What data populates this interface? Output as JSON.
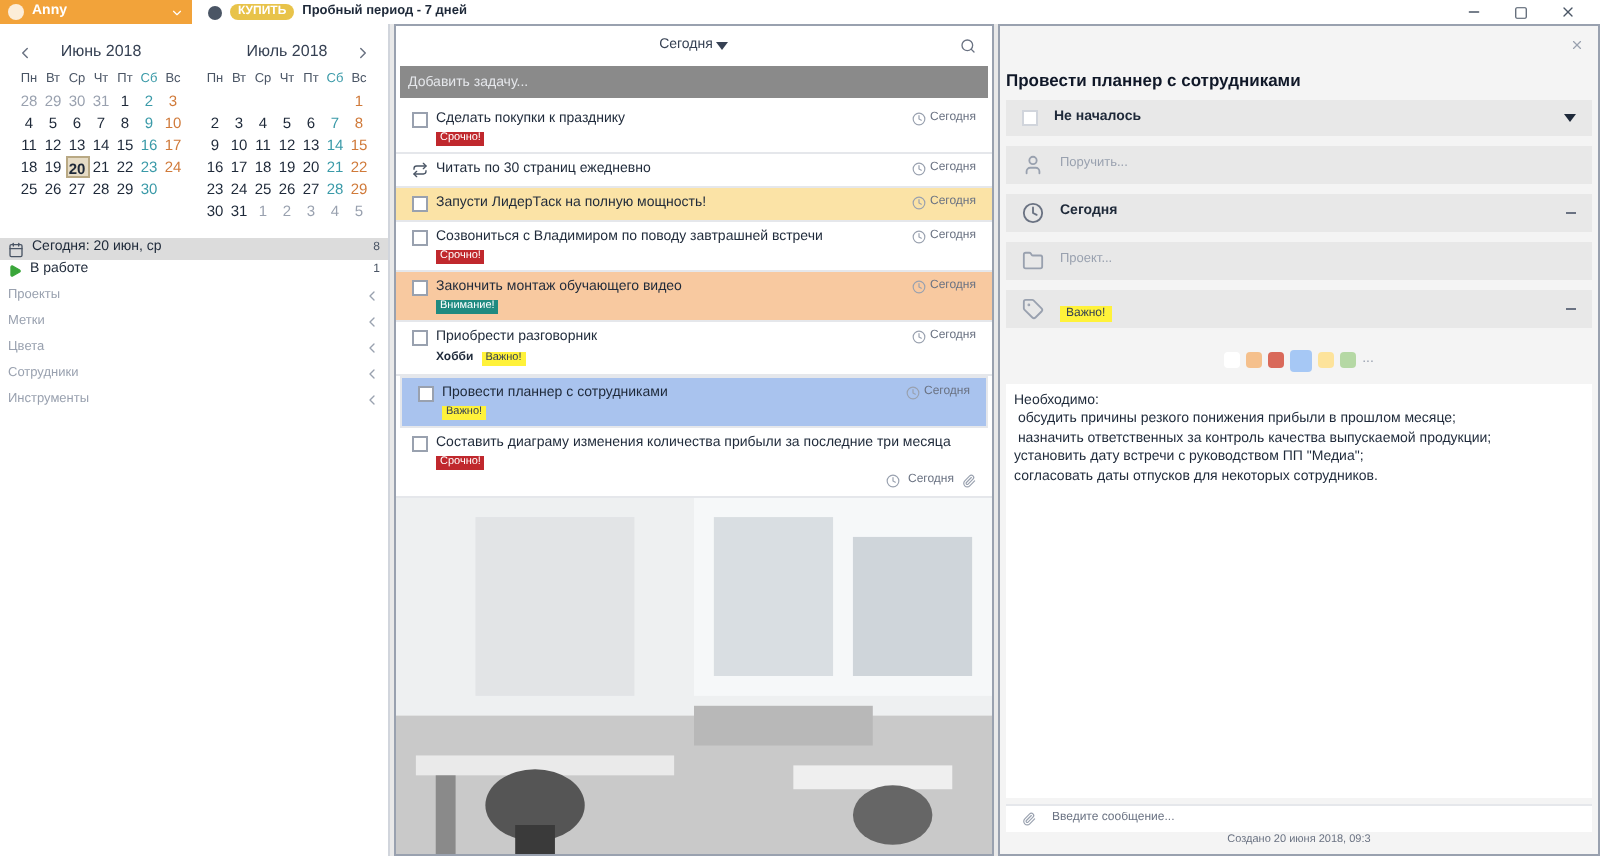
{
  "user": {
    "name": "Anny"
  },
  "topbar": {
    "buy": "КУПИТЬ",
    "trial": "Пробный период - 7 дней"
  },
  "calendars": [
    {
      "month": "Июнь 2018",
      "weekdays": [
        "Пн",
        "Вт",
        "Ср",
        "Чт",
        "Пт",
        "Сб",
        "Вс"
      ],
      "weeks": [
        [
          {
            "d": "28",
            "muted": true,
            "selected": false
          },
          {
            "d": "29",
            "muted": true,
            "selected": false
          },
          {
            "d": "30",
            "muted": true,
            "selected": false
          },
          {
            "d": "31",
            "muted": true,
            "selected": false
          },
          {
            "d": "1",
            "muted": false,
            "selected": false
          },
          {
            "d": "2",
            "muted": false,
            "selected": false
          },
          {
            "d": "3",
            "muted": false,
            "selected": false
          }
        ],
        [
          {
            "d": "4",
            "muted": false,
            "selected": false
          },
          {
            "d": "5",
            "muted": false,
            "selected": false
          },
          {
            "d": "6",
            "muted": false,
            "selected": false
          },
          {
            "d": "7",
            "muted": false,
            "selected": false
          },
          {
            "d": "8",
            "muted": false,
            "selected": false
          },
          {
            "d": "9",
            "muted": false,
            "selected": false
          },
          {
            "d": "10",
            "muted": false,
            "selected": false
          }
        ],
        [
          {
            "d": "11",
            "muted": false,
            "selected": false
          },
          {
            "d": "12",
            "muted": false,
            "selected": false
          },
          {
            "d": "13",
            "muted": false,
            "selected": false
          },
          {
            "d": "14",
            "muted": false,
            "selected": false
          },
          {
            "d": "15",
            "muted": false,
            "selected": false
          },
          {
            "d": "16",
            "muted": false,
            "selected": false
          },
          {
            "d": "17",
            "muted": false,
            "selected": false
          }
        ],
        [
          {
            "d": "18",
            "muted": false,
            "selected": false
          },
          {
            "d": "19",
            "muted": false,
            "selected": false
          },
          {
            "d": "20",
            "muted": false,
            "selected": true
          },
          {
            "d": "21",
            "muted": false,
            "selected": false
          },
          {
            "d": "22",
            "muted": false,
            "selected": false
          },
          {
            "d": "23",
            "muted": false,
            "selected": false
          },
          {
            "d": "24",
            "muted": false,
            "selected": false
          }
        ],
        [
          {
            "d": "25",
            "muted": false,
            "selected": false
          },
          {
            "d": "26",
            "muted": false,
            "selected": false
          },
          {
            "d": "27",
            "muted": false,
            "selected": false
          },
          {
            "d": "28",
            "muted": false,
            "selected": false
          },
          {
            "d": "29",
            "muted": false,
            "selected": false
          },
          {
            "d": "30",
            "muted": false,
            "selected": false
          }
        ]
      ]
    },
    {
      "month": "Июль 2018",
      "weekdays": [
        "Пн",
        "Вт",
        "Ср",
        "Чт",
        "Пт",
        "Сб",
        "Вс"
      ],
      "weeks": [
        [
          {
            "d": "1",
            "muted": false,
            "selected": false
          }
        ],
        [
          {
            "d": "2",
            "muted": false,
            "selected": false
          },
          {
            "d": "3",
            "muted": false,
            "selected": false
          },
          {
            "d": "4",
            "muted": false,
            "selected": false
          },
          {
            "d": "5",
            "muted": false,
            "selected": false
          },
          {
            "d": "6",
            "muted": false,
            "selected": false
          },
          {
            "d": "7",
            "muted": false,
            "selected": false
          },
          {
            "d": "8",
            "muted": false,
            "selected": false
          }
        ],
        [
          {
            "d": "9",
            "muted": false,
            "selected": false
          },
          {
            "d": "10",
            "muted": false,
            "selected": false
          },
          {
            "d": "11",
            "muted": false,
            "selected": false
          },
          {
            "d": "12",
            "muted": false,
            "selected": false
          },
          {
            "d": "13",
            "muted": false,
            "selected": false
          },
          {
            "d": "14",
            "muted": false,
            "selected": false
          },
          {
            "d": "15",
            "muted": false,
            "selected": false
          }
        ],
        [
          {
            "d": "16",
            "muted": false,
            "selected": false
          },
          {
            "d": "17",
            "muted": false,
            "selected": false
          },
          {
            "d": "18",
            "muted": false,
            "selected": false
          },
          {
            "d": "19",
            "muted": false,
            "selected": false
          },
          {
            "d": "20",
            "muted": false,
            "selected": false
          },
          {
            "d": "21",
            "muted": false,
            "selected": false
          },
          {
            "d": "22",
            "muted": false,
            "selected": false
          }
        ],
        [
          {
            "d": "23",
            "muted": false,
            "selected": false
          },
          {
            "d": "24",
            "muted": false,
            "selected": false
          },
          {
            "d": "25",
            "muted": false,
            "selected": false
          },
          {
            "d": "26",
            "muted": false,
            "selected": false
          },
          {
            "d": "27",
            "muted": false,
            "selected": false
          },
          {
            "d": "28",
            "muted": false,
            "selected": false
          },
          {
            "d": "29",
            "muted": false,
            "selected": false
          }
        ],
        [
          {
            "d": "30",
            "muted": false,
            "selected": false
          },
          {
            "d": "31",
            "muted": false,
            "selected": false
          },
          {
            "d": "1",
            "muted": true,
            "selected": false
          },
          {
            "d": "2",
            "muted": true,
            "selected": false
          },
          {
            "d": "3",
            "muted": true,
            "selected": false
          },
          {
            "d": "4",
            "muted": true,
            "selected": false
          },
          {
            "d": "5",
            "muted": true,
            "selected": false
          }
        ]
      ]
    }
  ],
  "filters": [
    {
      "kind": "today",
      "label": "Сегодня: 20 июн, ср",
      "count": "8",
      "selected": true
    },
    {
      "kind": "work",
      "label": "В работе",
      "count": "1",
      "selected": false
    }
  ],
  "sections": [
    {
      "label": "Проекты"
    },
    {
      "label": "Метки"
    },
    {
      "label": "Цвета"
    },
    {
      "label": "Сотрудники"
    },
    {
      "label": "Инструменты"
    }
  ],
  "list": {
    "header": "Сегодня",
    "add_placeholder": "Добавить задачу...",
    "tasks": [
      {
        "kind": "checkbox",
        "title": "Сделать покупки к празднику",
        "tags": [
          {
            "text": "Срочно!",
            "color": "#c0282d"
          }
        ],
        "date": "Сегодня",
        "color": "#ffffff",
        "selected": false,
        "attachment": false
      },
      {
        "kind": "recurring",
        "title": "Читать по 30 страниц ежедневно",
        "date": "Сегодня",
        "color": "#ffffff",
        "selected": false,
        "attachment": false
      },
      {
        "kind": "checkbox",
        "title": "Запусти ЛидерТаск на полную мощность!",
        "date": "Сегодня",
        "color": "#fbe3a6",
        "selected": false,
        "attachment": false
      },
      {
        "kind": "checkbox",
        "title": "Созвониться с Владимиром по поводу завтрашней встречи",
        "tags": [
          {
            "text": "Срочно!",
            "color": "#c0282d"
          }
        ],
        "date": "Сегодня",
        "color": "#ffffff",
        "selected": false,
        "attachment": false
      },
      {
        "kind": "checkbox",
        "title": "Закончить монтаж обучающего видео",
        "tags": [
          {
            "text": "Внимание!",
            "color": "#1f8a80"
          }
        ],
        "date": "Сегодня",
        "color": "#f8c9a0",
        "selected": false,
        "attachment": false
      },
      {
        "kind": "checkbox",
        "title": "Приобрести разговорник",
        "project": "Хобби",
        "tags": [
          {
            "text": "Важно!",
            "color": "#fff23a"
          }
        ],
        "date": "Сегодня",
        "color": "#ffffff",
        "selected": false,
        "attachment": false
      },
      {
        "kind": "checkbox",
        "title": "Провести планнер с сотрудниками",
        "tags": [
          {
            "text": "Важно!",
            "color": "#fff23a"
          }
        ],
        "date": "Сегодня",
        "color": "#a9c3ee",
        "selected": true,
        "attachment": false
      },
      {
        "kind": "checkbox",
        "title": "Составить диаграму изменения количества прибыли за последние три месяца",
        "tags": [
          {
            "text": "Срочно!",
            "color": "#c0282d"
          }
        ],
        "date": "Сегодня",
        "color": "#ffffff",
        "selected": false,
        "attachment": true
      }
    ]
  },
  "detail": {
    "title": "Провести планнер с сотрудниками",
    "status": "Не началось",
    "checked": false,
    "fields": [
      {
        "kind": "assignee",
        "placeholder": "Поручить..."
      },
      {
        "kind": "date",
        "value": "Сегодня"
      },
      {
        "kind": "project",
        "placeholder": "Проект..."
      },
      {
        "kind": "tag",
        "value": "Важно!",
        "color": "#fff23a"
      }
    ],
    "swatches": [
      {
        "color": "#ffffff",
        "selected": false
      },
      {
        "color": "#f5c08c",
        "selected": false
      },
      {
        "color": "#d9695a",
        "selected": false
      },
      {
        "color": "#a6c8f5",
        "selected": true
      },
      {
        "color": "#fde39b",
        "selected": false
      },
      {
        "color": "#b5d8a4",
        "selected": false
      }
    ],
    "more": "...",
    "notes": [
      "Необходимо:",
      " обсудить причины резкого понижения прибыли в прошлом месяце;",
      " назначить ответственных за контроль качества выпускаемой продукции;",
      "установить дату встречи с руководством ПП \"Медиа\";",
      "согласовать даты отпусков для некоторых сотрудников."
    ],
    "message_placeholder": "Введите сообщение...",
    "created": "Создано 20 июня 2018, 09:3"
  }
}
